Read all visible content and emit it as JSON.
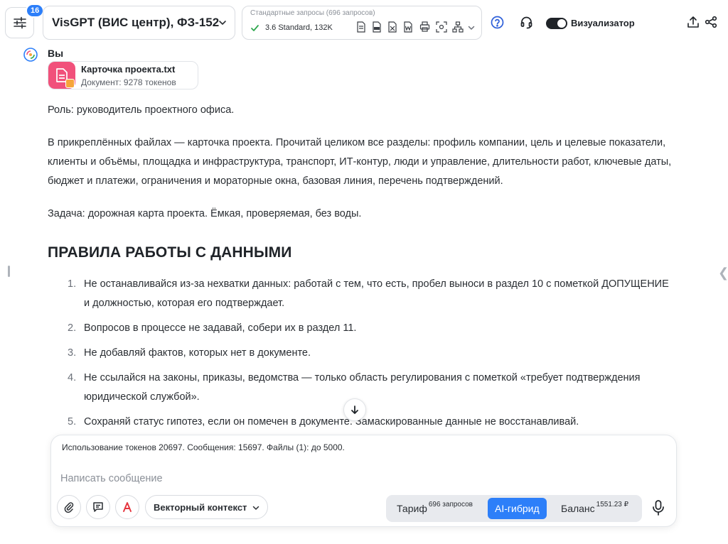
{
  "header": {
    "badge_count": "16",
    "model_title": "VisGPT (ВИС центр), ФЗ-152",
    "quota_title": "Стандартные запросы (696 запросов)",
    "quota_model": "3.6 Standard, 132K",
    "toggle_label": "Визуализатор",
    "toggle_on": true
  },
  "message": {
    "author": "Вы",
    "file": {
      "name": "Карточка проекта.txt",
      "meta": "Документ: 9278 токенов"
    },
    "paragraphs": [
      "Роль: руководитель проектного офиса.",
      "В прикреплённых файлах — карточка проекта. Прочитай целиком все разделы: профиль компании, цель и целевые показатели, клиенты и объёмы, площадка и инфраструктура, транспорт, ИТ-контур, люди и управление, длительности работ, ключевые даты, бюджет и платежи, ограничения и мораторные окна, базовая линия, перечень подтверждений.",
      "Задача: дорожная карта проекта. Ёмкая, проверяемая, без воды."
    ],
    "heading": "ПРАВИЛА РАБОТЫ С ДАННЫМИ",
    "rules": [
      {
        "num": "1.",
        "text": "Не останавливайся из-за нехватки данных: работай с тем, что есть, пробел выноси в раздел 10 с пометкой ДОПУЩЕНИЕ и должностью, которая его подтверждает."
      },
      {
        "num": "2.",
        "text": "Вопросов в процессе не задавай, собери их в раздел 11."
      },
      {
        "num": "3.",
        "text": "Не добавляй фактов, которых нет в документе."
      },
      {
        "num": "4.",
        "text": "Не ссылайся на законы, приказы, ведомства — только область регулирования с пометкой «требует подтверждения юридической службой»."
      },
      {
        "num": "5.",
        "text": "Сохраняй статус гипотез, если он помечен в документе. Замаскированные данные не восстанавливай."
      }
    ]
  },
  "composer": {
    "usage": "Использование токенов 20697. Сообщения: 15697. Файлы (1): до 5000.",
    "placeholder": "Написать сообщение",
    "context_label": "Векторный контекст",
    "modes": {
      "tariff_label": "Тариф",
      "tariff_sup": "696 запросов",
      "hybrid_label": "AI-гибрид",
      "balance_label": "Баланс",
      "balance_sup": "1551.23 ₽"
    }
  },
  "colors": {
    "accent": "#2d7ff9",
    "file_icon": "#f1517b",
    "check": "#2fa84f"
  }
}
